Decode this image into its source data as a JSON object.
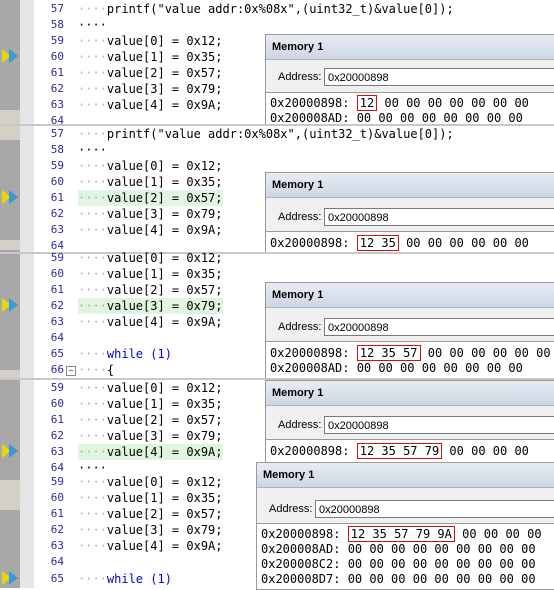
{
  "code": {
    "printf_line": "printf(\"value addr:0x%08x\",(uint32_t)&value[0]);",
    "assign": [
      "value[0] = 0x12;",
      "value[1] = 0x35;",
      "value[2] = 0x57;",
      "value[3] = 0x79;",
      "value[4] = 0x9A;"
    ],
    "while_line": "while (1)",
    "brace": "{"
  },
  "line_numbers": {
    "p1": [
      "57",
      "58",
      "59",
      "60",
      "61",
      "62",
      "63",
      "64"
    ],
    "p2": [
      "57",
      "58",
      "59",
      "60",
      "61",
      "62",
      "63",
      "64"
    ],
    "p3": [
      "59",
      "60",
      "61",
      "62",
      "63",
      "64",
      "65",
      "66"
    ],
    "p4": [
      "59",
      "60",
      "61",
      "62",
      "63",
      "64"
    ],
    "p5": [
      "59",
      "60",
      "61",
      "62",
      "63",
      "64",
      "65"
    ]
  },
  "memory": {
    "title": "Memory 1",
    "address_label": "Address:",
    "address_value": "0x20000898",
    "p1": {
      "addr": "0x20000898:",
      "hl": "12",
      "rest": " 00 00 00 00 00 00 00",
      "addr2": "0x200008AD:",
      "line2": " 00 00 00 00 00 00 00 00"
    },
    "p2": {
      "addr": "0x20000898:",
      "hl": "12 35",
      "rest": " 00 00 00 00 00 00"
    },
    "p3": {
      "addr": "0x20000898:",
      "hl": "12 35 57",
      "rest": " 00 00 00 00 00 00",
      "addr2": "0x200008AD:",
      "line2": " 00 00 00 00 00 00 00 00"
    },
    "p4": {
      "addr": "0x20000898:",
      "hl": "12 35 57 79",
      "rest": " 00 00 00 00"
    },
    "p5": {
      "addr": "0x20000898:",
      "hl": "12 35 57 79 9A",
      "rest": " 00 00 00 00",
      "extra": [
        {
          "addr": "0x200008AD:",
          "vals": " 00 00 00 00 00 00 00 00 00"
        },
        {
          "addr": "0x200008C2:",
          "vals": " 00 00 00 00 00 00 00 00 00"
        },
        {
          "addr": "0x200008D7:",
          "vals": " 00 00 00 00 00 00 00 00 00"
        }
      ]
    }
  },
  "colors": {
    "arrow": "#e8d800",
    "highlight_row": "#dff5df",
    "red_box": "#d01010"
  },
  "icons": [
    "current-line-arrow-icon",
    "fold-toggle-icon"
  ]
}
